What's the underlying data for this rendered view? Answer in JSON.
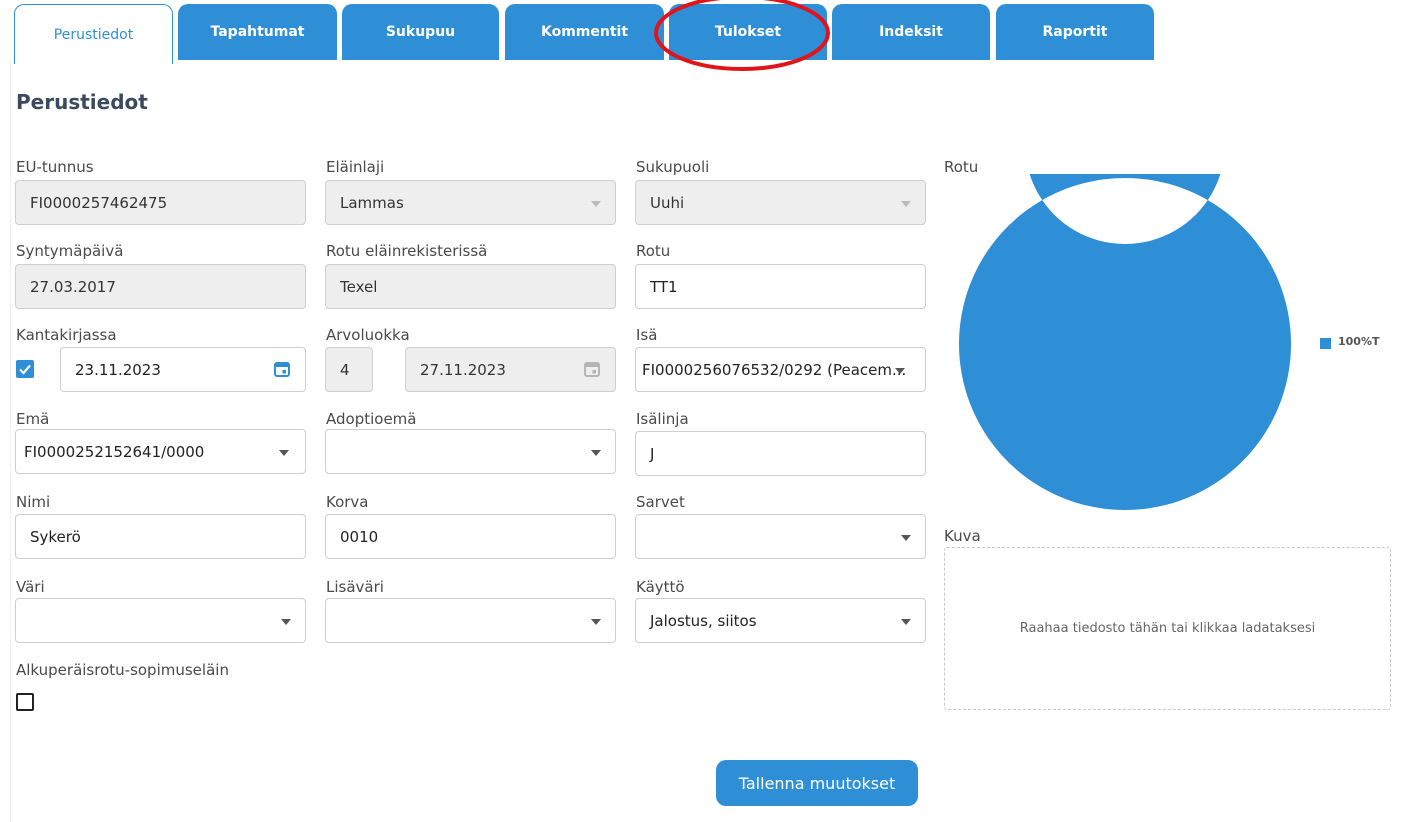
{
  "tabs": [
    "Perustiedot",
    "Tapahtumat",
    "Sukupuu",
    "Kommentit",
    "Tulokset",
    "Indeksit",
    "Raportit"
  ],
  "section_title": "Perustiedot",
  "fields": {
    "eu_tunnus": {
      "label": "EU-tunnus",
      "value": "FI0000257462475"
    },
    "elainlaji": {
      "label": "Eläinlaji",
      "value": "Lammas"
    },
    "sukupuoli": {
      "label": "Sukupuoli",
      "value": "Uuhi"
    },
    "syntymapaiva": {
      "label": "Syntymäpäivä",
      "value": "27.03.2017"
    },
    "rotu_rekisterissa": {
      "label": "Rotu eläinrekisterissä",
      "value": "Texel"
    },
    "rotu": {
      "label": "Rotu",
      "value": "TT1"
    },
    "kantakirjassa": {
      "label": "Kantakirjassa",
      "checked": true,
      "date": "23.11.2023"
    },
    "arvoluokka": {
      "label": "Arvoluokka",
      "value": "4",
      "date": "27.11.2023"
    },
    "isa": {
      "label": "Isä",
      "value": "FI0000256076532/0292 (Peacem..."
    },
    "ema": {
      "label": "Emä",
      "value": "FI0000252152641/0000"
    },
    "adoptioema": {
      "label": "Adoptioemä",
      "value": ""
    },
    "isalinja": {
      "label": "Isälinja",
      "value": "J"
    },
    "nimi": {
      "label": "Nimi",
      "value": "Sykerö"
    },
    "korva": {
      "label": "Korva",
      "value": "0010"
    },
    "sarvet": {
      "label": "Sarvet",
      "value": ""
    },
    "vari": {
      "label": "Väri",
      "value": ""
    },
    "lisavari": {
      "label": "Lisäväri",
      "value": ""
    },
    "kaytto": {
      "label": "Käyttö",
      "value": "Jalostus, siitos"
    },
    "alkuperaisrotu": {
      "label": "Alkuperäisrotu-sopimuseläin",
      "checked": false
    }
  },
  "rotu_chart": {
    "label": "Rotu",
    "legend": "100%T"
  },
  "chart_data": {
    "type": "pie",
    "title": "",
    "categories": [
      "100%T"
    ],
    "values": [
      100
    ],
    "donut": true,
    "legend_position": "right",
    "colors": [
      "#2f8fd6"
    ]
  },
  "kuva": {
    "label": "Kuva",
    "dropzone_text": "Raahaa tiedosto tähän tai klikkaa ladataksesi"
  },
  "save_button": "Tallenna muutokset",
  "annotation": {
    "highlight": "Tulokset",
    "color": "#e0141a"
  },
  "accent_color": "#2f8fd6"
}
